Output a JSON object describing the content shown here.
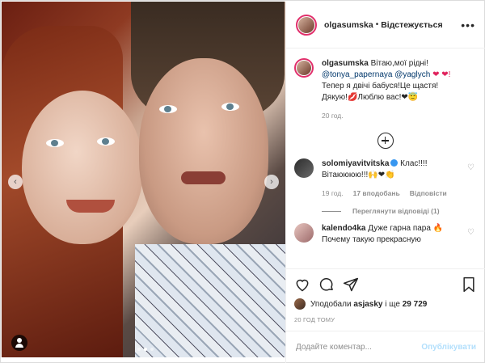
{
  "post": {
    "username": "olgasumska",
    "separator": "•",
    "follow_label": "Відстежується",
    "caption": {
      "username": "olgasumska",
      "line1": "Вітаю,мої рідні!",
      "mention1": "@tonya_papernaya",
      "mention2": "@yaglych",
      "line1_emoji": "❤ ❤!",
      "line2": "Тепер я двічі бабуся!Це щастя!",
      "line3": "Дякую!💋Люблю вас!❤😇",
      "time": "20 год."
    }
  },
  "comments": [
    {
      "username": "solomiyavitvitska",
      "text_line1": "Клас!!!!",
      "text_line2": "Вітаюююю!!!🙌❤👏",
      "time": "19 год.",
      "likes": "17 вподобань",
      "reply": "Відповісти",
      "view_replies": "Переглянути відповіді (1)"
    },
    {
      "username": "kalendo4ka",
      "text_line1": "Дуже гарна пара 🔥",
      "text_line2": "Почему такую прекрасную"
    }
  ],
  "likes": {
    "prefix": "Уподобали",
    "user": "asjasky",
    "middle": "і ще",
    "count": "29 729"
  },
  "timestamp": "20 ГОД ТОМУ",
  "add_comment": {
    "placeholder": "Додайте коментар...",
    "publish": "Опублікувати"
  },
  "icons": {
    "more": "more-options-icon",
    "like": "heart-icon",
    "comment": "comment-icon",
    "share": "share-icon",
    "save": "bookmark-icon",
    "add": "plus-circle-icon"
  },
  "colors": {
    "accent": "#3897f0",
    "link": "#00376b",
    "muted": "#8e8e8e",
    "publish_disabled": "#b2dffc"
  }
}
